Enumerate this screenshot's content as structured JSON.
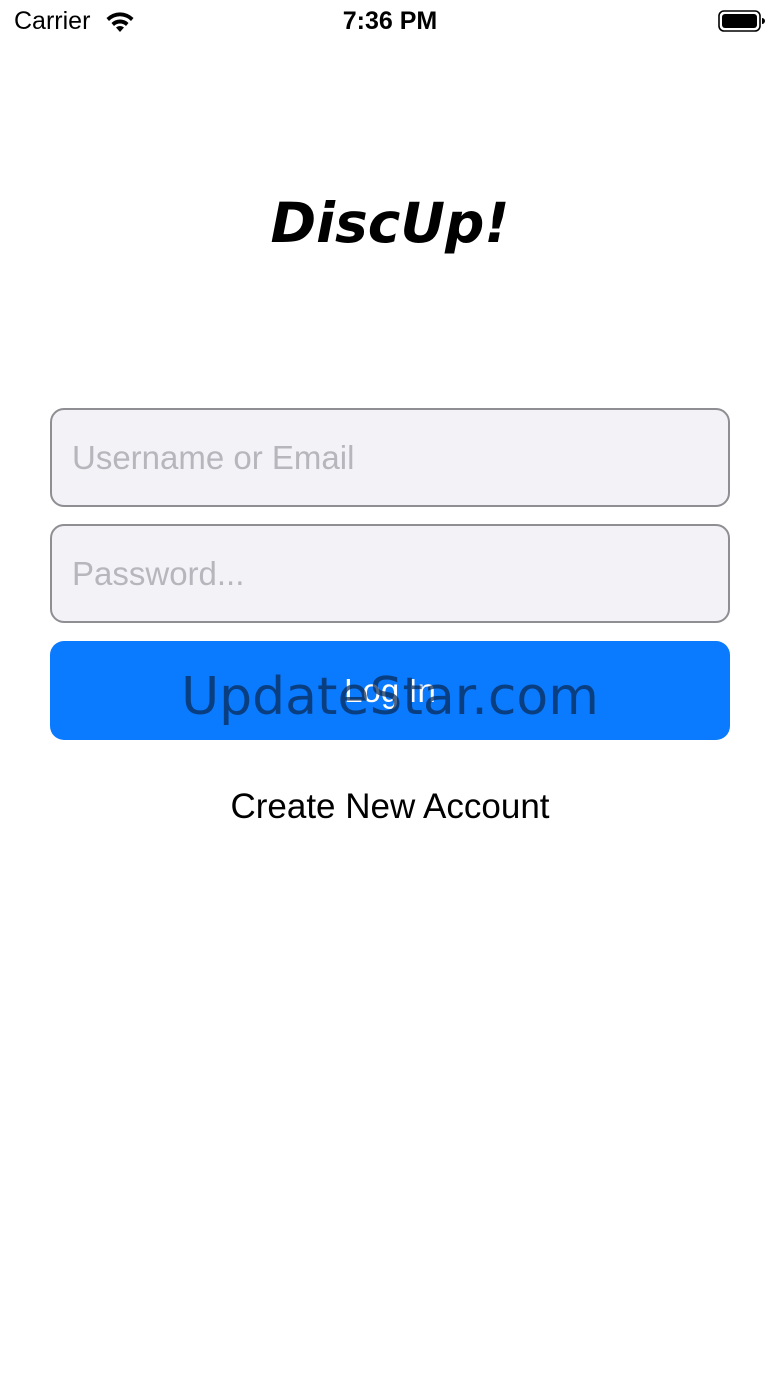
{
  "status_bar": {
    "carrier": "Carrier",
    "time": "7:36 PM",
    "wifi_icon": "wifi-icon",
    "battery_icon": "battery-icon"
  },
  "app": {
    "title": "DiscUp!"
  },
  "login_form": {
    "username_placeholder": "Username or Email",
    "username_value": "",
    "password_placeholder": "Password...",
    "password_value": "",
    "login_label": "Log In",
    "create_account_label": "Create New Account"
  },
  "watermark": {
    "text": "UpdateStar.com"
  },
  "colors": {
    "accent": "#0a7aff",
    "field_background": "#f2f2f7",
    "field_border": "#8e8e93",
    "placeholder": "#b6b6bc"
  }
}
